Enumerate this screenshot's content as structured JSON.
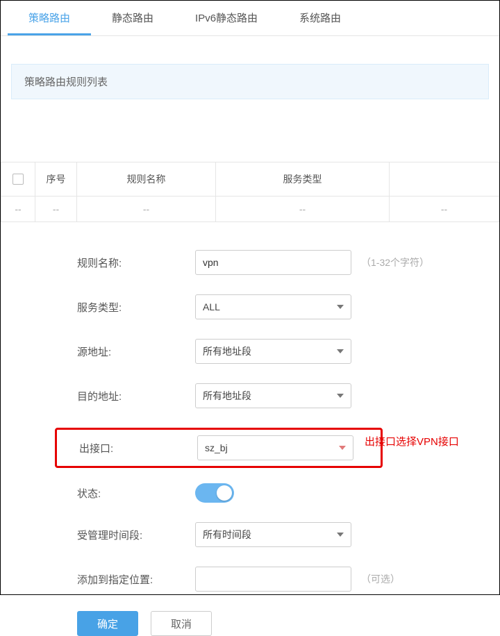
{
  "tabs": [
    {
      "label": "策略路由",
      "active": true
    },
    {
      "label": "静态路由",
      "active": false
    },
    {
      "label": "IPv6静态路由",
      "active": false
    },
    {
      "label": "系统路由",
      "active": false
    }
  ],
  "sectionTitle": "策略路由规则列表",
  "table": {
    "headers": {
      "seq": "序号",
      "name": "规则名称",
      "svc": "服务类型"
    },
    "placeholder": "--"
  },
  "form": {
    "ruleName": {
      "label": "规则名称:",
      "value": "vpn",
      "hint": "（1-32个字符）"
    },
    "svcType": {
      "label": "服务类型:",
      "value": "ALL"
    },
    "srcAddr": {
      "label": "源地址:",
      "value": "所有地址段"
    },
    "dstAddr": {
      "label": "目的地址:",
      "value": "所有地址段"
    },
    "outIf": {
      "label": "出接口:",
      "value": "sz_bj",
      "annot": "出接口选择VPN接口"
    },
    "status": {
      "label": "状态:"
    },
    "mgmtTime": {
      "label": "受管理时间段:",
      "value": "所有时间段"
    },
    "addPos": {
      "label": "添加到指定位置:",
      "value": "",
      "hint": "（可选）"
    },
    "okBtn": "确定",
    "cancelBtn": "取消"
  }
}
